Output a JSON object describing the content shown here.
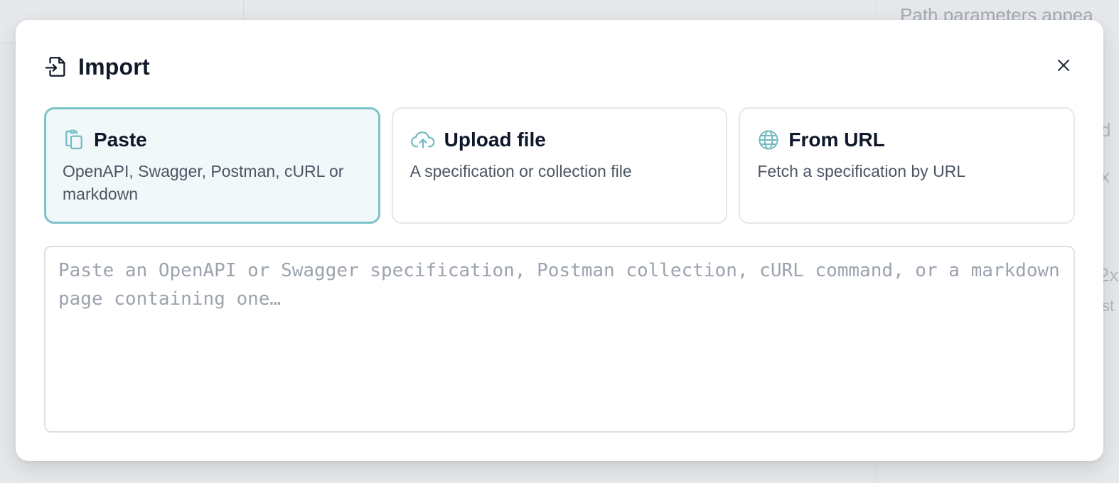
{
  "background": {
    "right_panel_text": "Path parameters appea",
    "fragments": [
      "d",
      "x",
      "2x",
      "st"
    ]
  },
  "dialog": {
    "title": "Import",
    "title_icon": "file-import-icon",
    "close_icon": "close-icon"
  },
  "options": [
    {
      "label": "Paste",
      "description": "OpenAPI, Swagger, Postman, cURL or markdown",
      "icon": "clipboard-icon",
      "selected": true
    },
    {
      "label": "Upload file",
      "description": "A specification or collection file",
      "icon": "cloud-upload-icon",
      "selected": false
    },
    {
      "label": "From URL",
      "description": "Fetch a specification by URL",
      "icon": "globe-icon",
      "selected": false
    }
  ],
  "paste_input": {
    "value": "",
    "placeholder": "Paste an OpenAPI or Swagger specification, Postman collection, cURL command, or a markdown page containing one…"
  },
  "colors": {
    "accent": "#7cc3c9",
    "selected_bg": "#f0f8fa",
    "icon_teal": "#6fbac1"
  }
}
